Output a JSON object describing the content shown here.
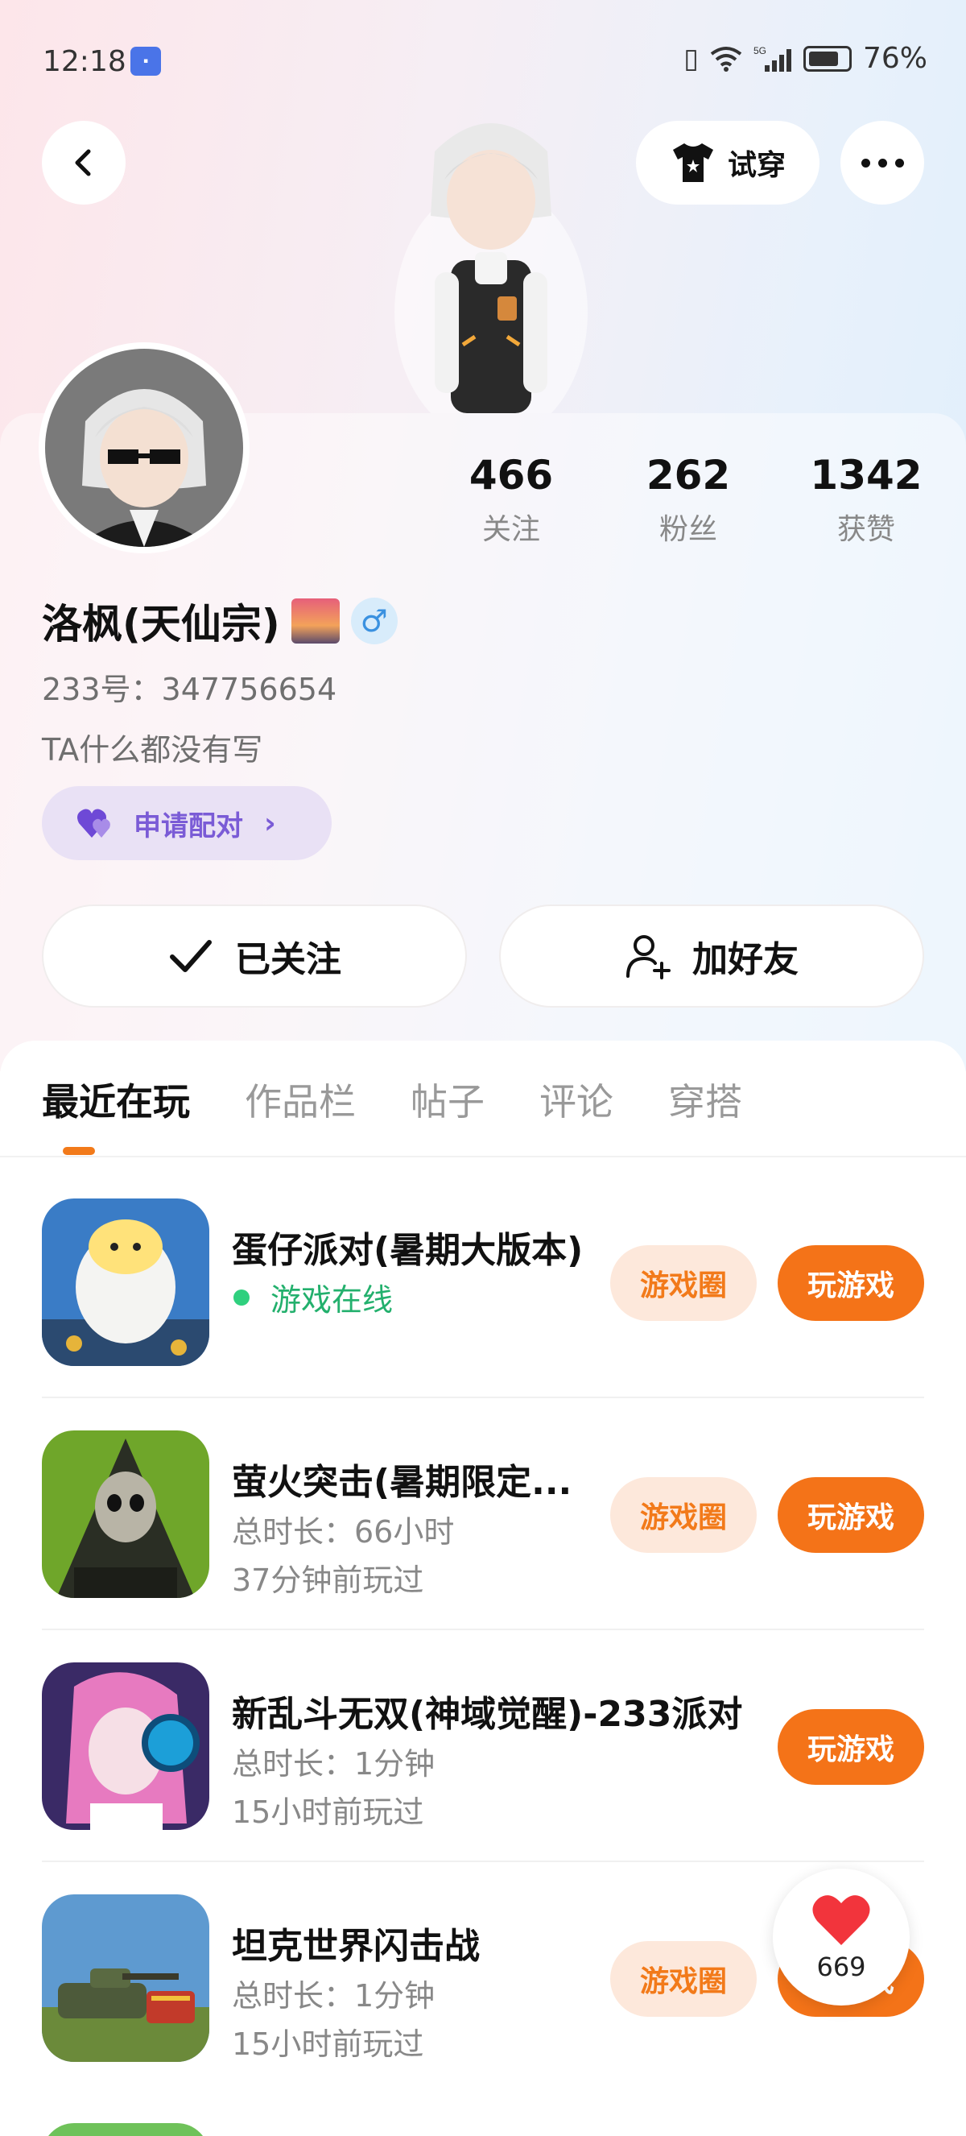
{
  "status_bar": {
    "time": "12:18",
    "battery_pct": "76%",
    "icons": [
      "vibrate-icon",
      "wifi-icon",
      "signal-5g-icon",
      "battery-icon"
    ]
  },
  "header": {
    "tryon_label": "试穿"
  },
  "profile": {
    "stats": [
      {
        "value": "466",
        "label": "关注"
      },
      {
        "value": "262",
        "label": "粉丝"
      },
      {
        "value": "1342",
        "label": "获赞"
      }
    ],
    "username": "洛枫(天仙宗)",
    "gender": "♂",
    "uid": "233号：347756654",
    "bio": "TA什么都没有写",
    "pair_label": "申请配对",
    "followed_label": "已关注",
    "add_friend_label": "加好友"
  },
  "tabs": [
    "最近在玩",
    "作品栏",
    "帖子",
    "评论",
    "穿搭"
  ],
  "games": [
    {
      "name": "蛋仔派对(暑期大版本)",
      "line2": "游戏在线",
      "line3": "",
      "circle": "游戏圈",
      "play": "玩游戏"
    },
    {
      "name": "萤火突击(暑期限定...",
      "line2": "总时长：66小时",
      "line3": "37分钟前玩过",
      "circle": "游戏圈",
      "play": "玩游戏"
    },
    {
      "name": "新乱斗无双(神域觉醒)-233派对",
      "line2": "总时长：1分钟",
      "line3": "15小时前玩过",
      "circle": "",
      "play": "玩游戏"
    },
    {
      "name": "坦克世界闪击战",
      "line2": "总时长：1分钟",
      "line3": "15小时前玩过",
      "circle": "游戏圈",
      "play": "玩游戏"
    }
  ],
  "like_float": {
    "count": "669"
  },
  "colors": {
    "accent": "#f47318",
    "pair": "#7a5bd6",
    "online": "#23b06d"
  }
}
